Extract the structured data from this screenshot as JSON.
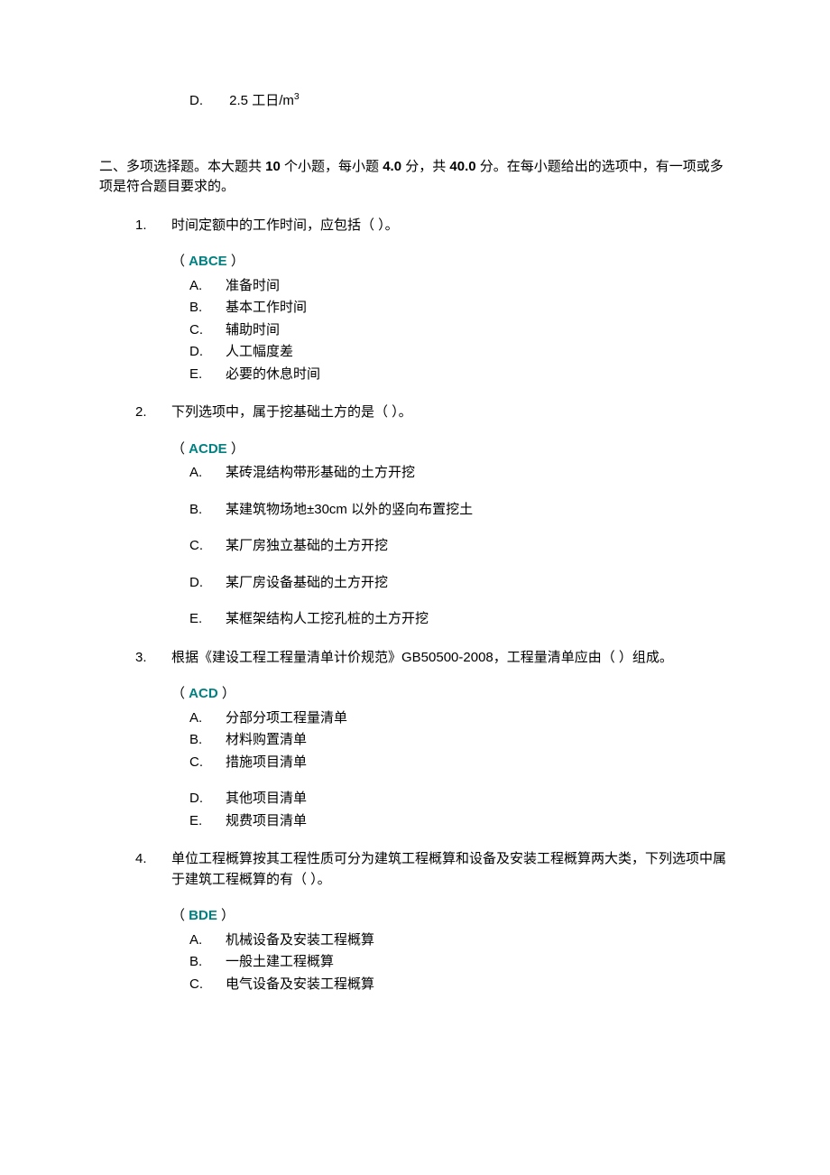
{
  "pre_option": {
    "label": "D.",
    "text_before_sup": "2.5 工日/m",
    "sup": "3"
  },
  "section2": {
    "header_parts": {
      "t1": "二、多项选择题。本大题共 ",
      "b1": "10",
      "t2": " 个小题，每小题 ",
      "b2": "4.0",
      "t3": " 分，共 ",
      "b3": "40.0",
      "t4": " 分。在每小题给出的选项中，有一项或多项是符合题目要求的。"
    },
    "questions": [
      {
        "num": "1.",
        "text": "时间定额中的工作时间，应包括（  ）。",
        "answer": "ABCE",
        "spaced": false,
        "options": [
          {
            "label": "A.",
            "text": "准备时间"
          },
          {
            "label": "B.",
            "text": "基本工作时间"
          },
          {
            "label": "C.",
            "text": "辅助时间"
          },
          {
            "label": "D.",
            "text": "人工幅度差"
          },
          {
            "label": "E.",
            "text": "必要的休息时间"
          }
        ]
      },
      {
        "num": "2.",
        "text": "下列选项中，属于挖基础土方的是（  ）。",
        "answer": "ACDE",
        "spaced": true,
        "options": [
          {
            "label": "A.",
            "text": "某砖混结构带形基础的土方开挖"
          },
          {
            "label": "B.",
            "text": "某建筑物场地±30cm 以外的竖向布置挖土"
          },
          {
            "label": "C.",
            "text": "某厂房独立基础的土方开挖"
          },
          {
            "label": "D.",
            "text": "某厂房设备基础的土方开挖"
          },
          {
            "label": "E.",
            "text": "某框架结构人工挖孔桩的土方开挖"
          }
        ]
      },
      {
        "num": "3.",
        "text": "根据《建设工程工程量清单计价规范》GB50500-2008，工程量清单应由（  ）组成。",
        "answer": "ACD",
        "spaced": false,
        "options": [
          {
            "label": "A.",
            "text": "分部分项工程量清单"
          },
          {
            "label": "B.",
            "text": "材料购置清单"
          },
          {
            "label": "C.",
            "text": "措施项目清单"
          },
          {
            "label": "D.",
            "text": "其他项目清单",
            "gap_before": true
          },
          {
            "label": "E.",
            "text": "规费项目清单"
          }
        ]
      },
      {
        "num": "4.",
        "text": "单位工程概算按其工程性质可分为建筑工程概算和设备及安装工程概算两大类，下列选项中属于建筑工程概算的有（  ）。",
        "answer": "BDE",
        "spaced": false,
        "options": [
          {
            "label": "A.",
            "text": "机械设备及安装工程概算"
          },
          {
            "label": "B.",
            "text": "一般土建工程概算"
          },
          {
            "label": "C.",
            "text": "电气设备及安装工程概算"
          }
        ]
      }
    ]
  }
}
